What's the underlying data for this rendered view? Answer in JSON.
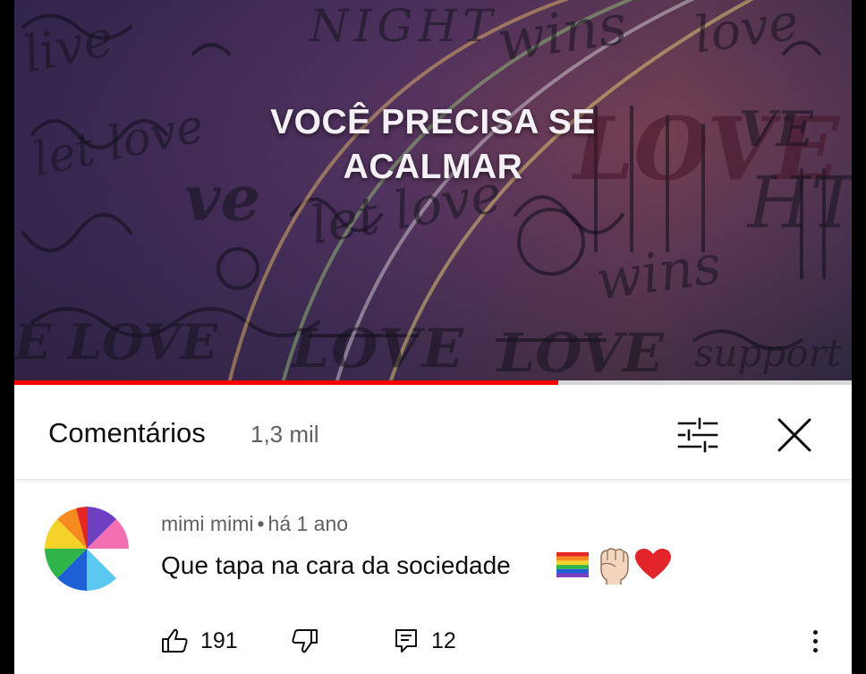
{
  "video": {
    "overlay_line1": "VOCÊ PRECISA SE",
    "overlay_line2": "ACALMAR",
    "progress": 0.65,
    "progress_color": "#ff0000"
  },
  "comments_panel": {
    "title": "Comentários",
    "count": "1,3 mil",
    "filter_icon": "sort-filter-icon",
    "close_icon": "close-icon"
  },
  "comment": {
    "author": "mimi mimi",
    "separator": "•",
    "time": "há 1 ano",
    "text": "Que tapa na cara da sociedade",
    "emojis": [
      "rainbow-flag-icon",
      "raised-fist-icon",
      "red-heart-icon"
    ],
    "likes": "191",
    "replies": "12"
  }
}
